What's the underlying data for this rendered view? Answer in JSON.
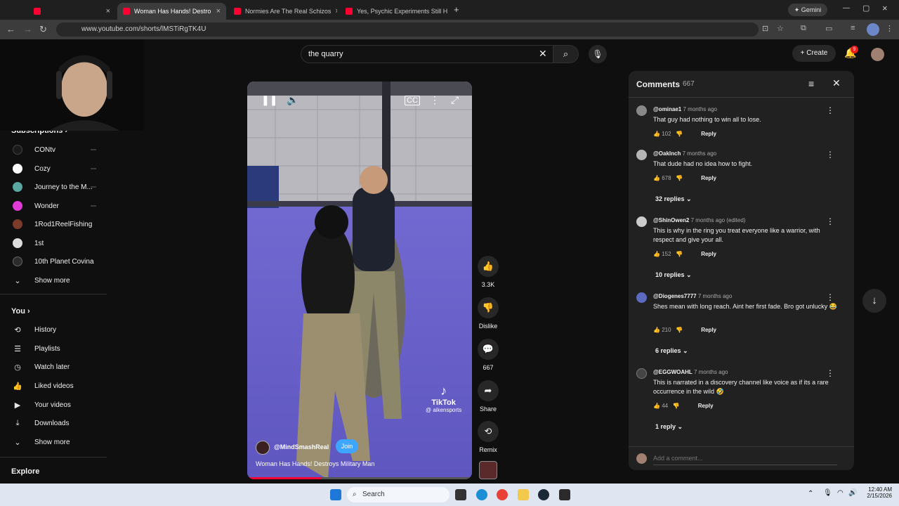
{
  "browser": {
    "tabs": [
      {
        "title": "Woman Has Hands! Destro",
        "active": true
      },
      {
        "title": "Normies Are The Real Schizos",
        "active": false
      },
      {
        "title": "Yes, Psychic Experiments Still H",
        "active": false
      }
    ],
    "new_tab": "+",
    "gemini": "Gemini",
    "url": "www.youtube.com/shorts/lMSTiRgTK4U"
  },
  "header": {
    "search_value": "the quarry",
    "create_label": "Create",
    "notification_count": "9"
  },
  "sidebar": {
    "subscriptions_label": "Subscriptions",
    "channels": [
      {
        "name": "CONtv",
        "color": "#1a1a1a"
      },
      {
        "name": "Cozy",
        "color": "#ffffff"
      },
      {
        "name": "Journey to the M...",
        "color": "#5aa6a1"
      },
      {
        "name": "Wonder",
        "color": "#e03bd6"
      },
      {
        "name": "1Rod1ReelFishing",
        "color": "#7b3b2a"
      },
      {
        "name": "1st",
        "color": "#dcdcdc"
      },
      {
        "name": "10th Planet Covina",
        "color": "#2c2c2c"
      }
    ],
    "show_more_1": "Show more",
    "you_label": "You",
    "you_items": [
      {
        "label": "History",
        "icon": "history-icon",
        "glyph": "⟲"
      },
      {
        "label": "Playlists",
        "icon": "playlists-icon",
        "glyph": "☰"
      },
      {
        "label": "Watch later",
        "icon": "clock-icon",
        "glyph": "◷"
      },
      {
        "label": "Liked videos",
        "icon": "thumb-up-icon",
        "glyph": "👍"
      },
      {
        "label": "Your videos",
        "icon": "video-icon",
        "glyph": "▶"
      },
      {
        "label": "Downloads",
        "icon": "download-icon",
        "glyph": "⤓"
      }
    ],
    "show_more_2": "Show more",
    "explore_label": "Explore"
  },
  "video": {
    "channel": "@MindSmashReal",
    "join_label": "Join",
    "title": "Woman Has Hands! Destroys Military Man",
    "watermark_brand": "TikTok",
    "watermark_handle": "@ aikensports",
    "progress": 0.33
  },
  "actions": {
    "likes": "3.3K",
    "dislike": "Dislike",
    "comments": "667",
    "share": "Share",
    "remix": "Remix"
  },
  "comments": {
    "title": "Comments",
    "count": "667",
    "items": [
      {
        "author": "@ominae1",
        "time": "7 months ago",
        "text": "That guy had nothing to win all to lose.",
        "likes": "102",
        "reply": "Reply",
        "replies": null,
        "avatar": "#888888"
      },
      {
        "author": "@Oaklnch",
        "time": "7 months ago",
        "text": "That dude had no idea how to fight.",
        "likes": "678",
        "reply": "Reply",
        "replies": "32 replies",
        "avatar": "#b5b5b5"
      },
      {
        "author": "@ShinOwen2",
        "time": "7 months ago (edited)",
        "text": "This is why in the ring you treat everyone like a warrior, with respect and give your all.",
        "likes": "152",
        "reply": "Reply",
        "replies": "10 replies",
        "avatar": "#cccccc"
      },
      {
        "author": "@Diogenes7777",
        "time": "7 months ago",
        "text": "Shes mean with long reach. Aint her first fade. Bro got unlucky 😂",
        "likes": "210",
        "reply": "Reply",
        "replies": "6 replies",
        "avatar": "#5c6bc0"
      },
      {
        "author": "@EGGWOAHL",
        "time": "7 months ago",
        "text": "This is narrated in a discovery channel like voice as if its a rare occurrence in the wild 🤣",
        "likes": "44",
        "reply": "Reply",
        "replies": "1 reply",
        "avatar": "#444444"
      }
    ],
    "add_placeholder": "Add a comment..."
  },
  "taskbar": {
    "search_label": "Search",
    "time": "12:40 AM",
    "date": "2/15/2026"
  }
}
